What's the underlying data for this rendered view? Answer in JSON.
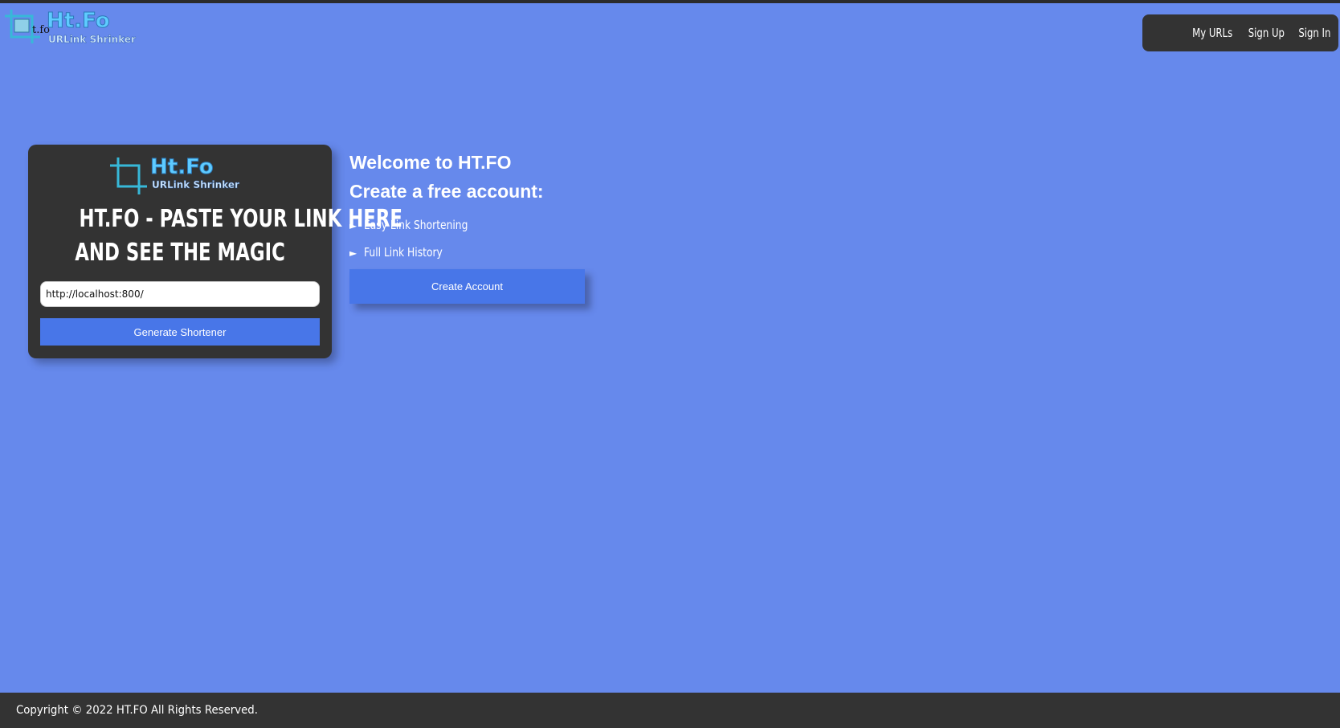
{
  "header": {
    "logo": {
      "text": "Ht.Fo",
      "tagline": "URLink Shrinker",
      "alt_text": "t.fo"
    },
    "nav": [
      {
        "label": "My URLs"
      },
      {
        "label": "Sign Up"
      },
      {
        "label": "Sign In"
      }
    ]
  },
  "card": {
    "logo": {
      "text": "Ht.Fo",
      "tagline": "URLink Shrinker"
    },
    "title_line1": "HT.FO - PASTE YOUR LINK HERE",
    "title_line2": "AND SEE THE MAGIC",
    "url_input_value": "http://localhost:800/",
    "generate_label": "Generate Shortener"
  },
  "welcome": {
    "heading": "Welcome to HT.FO",
    "subheading": "Create a free account:",
    "features": [
      {
        "arrow": "►",
        "text": "Easy Link Shortening"
      },
      {
        "arrow": "►",
        "text": "Full Link History"
      }
    ],
    "create_label": "Create Account"
  },
  "footer": {
    "copyright": "Copyright © 2022 HT.FO All Rights Reserved."
  },
  "colors": {
    "background": "#6689ec",
    "panel": "#333333",
    "button": "#4876e8",
    "logo": "#5ecbff"
  }
}
